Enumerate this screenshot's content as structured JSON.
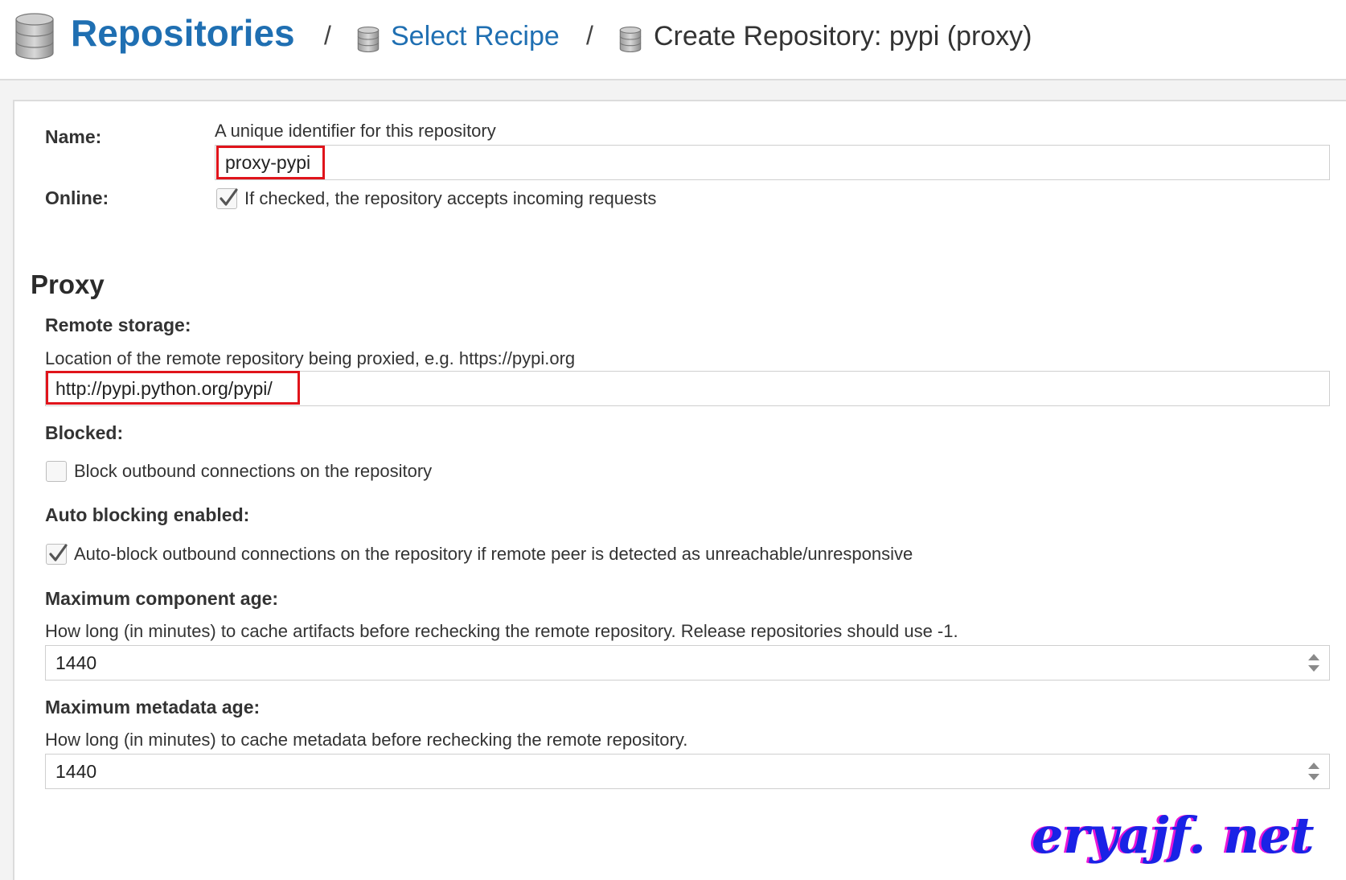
{
  "breadcrumb": {
    "root": "Repositories",
    "separator": "/",
    "select_recipe": "Select Recipe",
    "current": "Create Repository: pypi (proxy)"
  },
  "form": {
    "name": {
      "label": "Name:",
      "help": "A unique identifier for this repository",
      "value": "proxy-pypi"
    },
    "online": {
      "label": "Online:",
      "help": "If checked, the repository accepts incoming requests",
      "checked": true
    },
    "proxy": {
      "section_title": "Proxy",
      "remote_storage": {
        "label": "Remote storage:",
        "help": "Location of the remote repository being proxied, e.g. https://pypi.org",
        "value": "http://pypi.python.org/pypi/"
      },
      "blocked": {
        "label": "Blocked:",
        "help": "Block outbound connections on the repository",
        "checked": false
      },
      "auto_blocking": {
        "label": "Auto blocking enabled:",
        "help": "Auto-block outbound connections on the repository if remote peer is detected as unreachable/unresponsive",
        "checked": true
      },
      "max_component_age": {
        "label": "Maximum component age:",
        "help": "How long (in minutes) to cache artifacts before rechecking the remote repository. Release repositories should use -1.",
        "value": "1440"
      },
      "max_metadata_age": {
        "label": "Maximum metadata age:",
        "help": "How long (in minutes) to cache metadata before rechecking the remote repository.",
        "value": "1440"
      }
    }
  },
  "watermark": "eryajf. net",
  "colors": {
    "link": "#1f6fb2",
    "highlight": "#e0141b",
    "watermark": "#1a22e6",
    "watermark_shadow": "#e818d6"
  },
  "icons": [
    "database-icon",
    "checkmark-icon",
    "spinner-arrows-icon"
  ]
}
